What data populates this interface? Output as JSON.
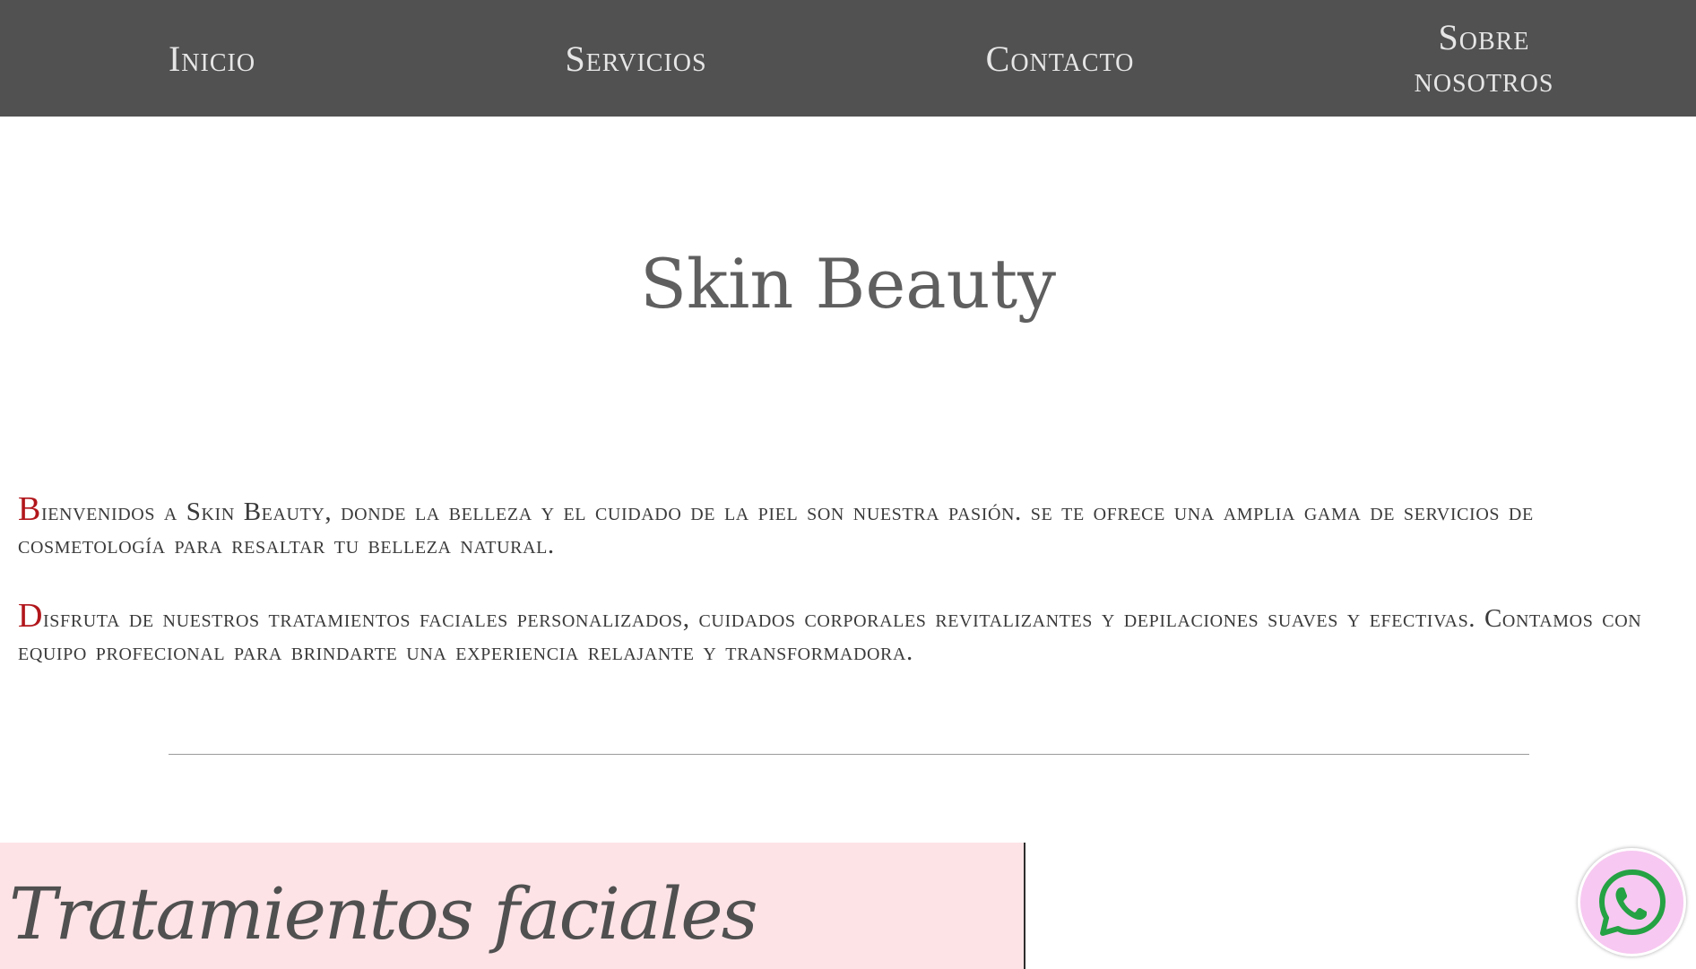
{
  "nav": {
    "items": [
      {
        "label": "Inicio"
      },
      {
        "label": "Servicios"
      },
      {
        "label": "Contacto"
      },
      {
        "label": "Sobre nosotros"
      }
    ],
    "background": "#515151"
  },
  "header": {
    "title": "Skin Beauty"
  },
  "intro": {
    "paragraphs": [
      {
        "initial": "B",
        "text": "ienvenidos a Skin Beauty, donde la belleza y el cuidado de la piel son nuestra pasión. se te ofrece una amplia gama de servicios de cosmetología para resaltar tu belleza natural."
      },
      {
        "initial": "D",
        "text": "isfruta de nuestros tratamientos faciales personalizados, cuidados corporales revitalizantes y depilaciones suaves y efectivas. Contamos con equipo profecional para brindarte una experiencia relajante y transformadora."
      }
    ],
    "initial_color": "#b1161b"
  },
  "section": {
    "title": "Tratamientos faciales",
    "background": "#fde3e6"
  },
  "floating": {
    "icon": "whatsapp-icon",
    "background": "#f7c8f1",
    "icon_color": "#25a244"
  }
}
